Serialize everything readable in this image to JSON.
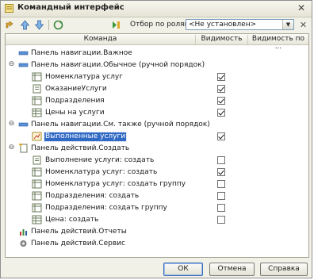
{
  "window": {
    "title": "Командный интерфейс"
  },
  "toolbar": {
    "filter_label": "Отбор по ролям:",
    "filter_value": "<Не установлен>"
  },
  "columns": {
    "command": "Команда",
    "visibility": "Видимость",
    "visibility_by": "Видимость по ..."
  },
  "rows": [
    {
      "label": "Панель навигации.Важное"
    },
    {
      "label": "Панель навигации.Обычное (ручной порядок)"
    },
    {
      "label": "Номенклатура услуг",
      "checked": true
    },
    {
      "label": "ОказаниеУслуги",
      "checked": true
    },
    {
      "label": "Подразделения",
      "checked": true
    },
    {
      "label": "Цены на услуги",
      "checked": true
    },
    {
      "label": "Панель навигации.См. также (ручной порядок)"
    },
    {
      "label": "Выполненные услуги",
      "checked": true
    },
    {
      "label": "Панель действий.Создать"
    },
    {
      "label": "Выполнение услуги: создать",
      "checked": false
    },
    {
      "label": "Номенклатура услуг: создать",
      "checked": true
    },
    {
      "label": "Номенклатура услуг: создать группу",
      "checked": false
    },
    {
      "label": "Подразделения: создать",
      "checked": false
    },
    {
      "label": "Подразделения: создать группу",
      "checked": false
    },
    {
      "label": "Цена: создать",
      "checked": false
    },
    {
      "label": "Панель действий.Отчеты"
    },
    {
      "label": "Панель действий.Сервис"
    }
  ],
  "footer": {
    "ok": "ОК",
    "cancel": "Отмена",
    "help": "Справка"
  }
}
